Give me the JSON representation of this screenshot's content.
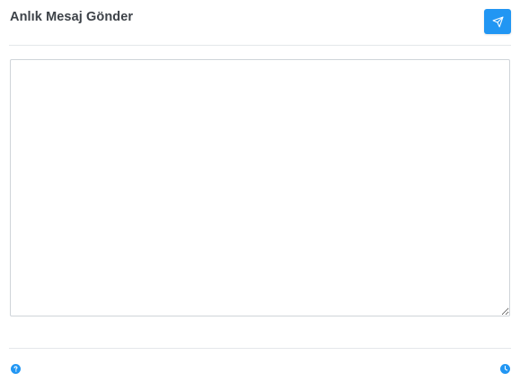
{
  "header": {
    "title": "Anlık Mesaj Gönder",
    "send_icon": "paper-plane-icon"
  },
  "message": {
    "value": "",
    "placeholder": ""
  },
  "footer": {
    "left_icon": "question-circle-icon",
    "right_icon": "clock-icon"
  },
  "colors": {
    "accent": "#2196f3",
    "title_text": "#3d4248",
    "divider": "#e4e7ea",
    "border": "#cfd4d9"
  }
}
